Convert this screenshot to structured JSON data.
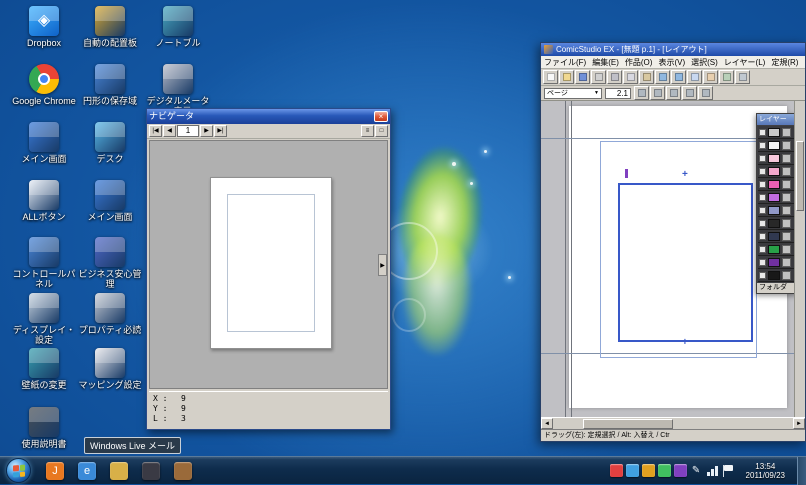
{
  "wallpaper": {
    "base_blue": "#10509a",
    "aurora_green": "#a6d83c"
  },
  "desktop": {
    "icons": [
      {
        "name": "dropbox",
        "label": "Dropbox",
        "kind": "dropbox",
        "color": "#1f8ce3",
        "col": 0,
        "row": 0
      },
      {
        "name": "google-chrome",
        "label": "Google Chrome",
        "kind": "chrome",
        "color": "#e8453c",
        "col": 0,
        "row": 1
      },
      {
        "name": "main-screen",
        "label": "メイン画面",
        "kind": "app",
        "color": "#3a7ad8",
        "col": 0,
        "row": 2
      },
      {
        "name": "all-button",
        "label": "ALLボタン",
        "kind": "app",
        "color": "#e8eef6",
        "col": 0,
        "row": 3
      },
      {
        "name": "control-panel",
        "label": "コントロールパネル",
        "kind": "app",
        "color": "#4a86d8",
        "col": 0,
        "row": 4
      },
      {
        "name": "display-settings",
        "label": "ディスプレイ・設定",
        "kind": "app",
        "color": "#c8d4e0",
        "col": 0,
        "row": 5
      },
      {
        "name": "wallpaper-change",
        "label": "壁紙の変更",
        "kind": "app",
        "color": "#38a0b0",
        "col": 0,
        "row": 6
      },
      {
        "name": "manual",
        "label": "使用説明書",
        "kind": "app",
        "color": "#485058",
        "col": 0,
        "row": 7
      },
      {
        "name": "auto-layout",
        "label": "自動の配置板",
        "kind": "app",
        "color": "#d8a830",
        "col": 1,
        "row": 0
      },
      {
        "name": "backup-area",
        "label": "円形の保存域",
        "kind": "app",
        "color": "#4a86d8",
        "col": 1,
        "row": 1
      },
      {
        "name": "desk",
        "label": "デスク",
        "kind": "app",
        "color": "#58b8e8",
        "col": 1,
        "row": 2
      },
      {
        "name": "main-screen-2",
        "label": "メイン画面",
        "kind": "app",
        "color": "#3a7ad8",
        "col": 1,
        "row": 3
      },
      {
        "name": "business-admin",
        "label": "ビジネス安心管理",
        "kind": "app",
        "color": "#5068c8",
        "col": 1,
        "row": 4
      },
      {
        "name": "property-readme",
        "label": "プロパティ必読",
        "kind": "app",
        "color": "#c8ccd4",
        "col": 1,
        "row": 5
      },
      {
        "name": "mapping-settings",
        "label": "マッピング設定",
        "kind": "app",
        "color": "#e8e8ec",
        "col": 1,
        "row": 6
      },
      {
        "name": "notable",
        "label": "ノートブル",
        "kind": "app",
        "color": "#48a8c0",
        "col": 2,
        "row": 0
      },
      {
        "name": "digital-meter",
        "label": "デジタルメーター表示",
        "kind": "app",
        "color": "#b8bcc8",
        "col": 2,
        "row": 1
      }
    ]
  },
  "navigator": {
    "title": "ナビゲータ",
    "close_label": "×",
    "toolbar": {
      "first": "|◀",
      "prev": "◀",
      "page": "1",
      "next": "▶",
      "last": "▶|",
      "view_buttons": [
        "≡",
        "□"
      ]
    },
    "readout": [
      {
        "label": "X :",
        "value": "9"
      },
      {
        "label": "Y :",
        "value": "9"
      },
      {
        "label": "L :",
        "value": "3"
      }
    ]
  },
  "comicstudio": {
    "title": "ComicStudio EX - [無題 p.1] - [レイアウト]",
    "menus": [
      "ファイル(F)",
      "編集(E)",
      "作品(O)",
      "表示(V)",
      "選択(S)",
      "レイヤー(L)",
      "定規(R)"
    ],
    "toolbar_icons": [
      {
        "name": "new",
        "color": "#f8f8f8"
      },
      {
        "name": "open",
        "color": "#f0d890"
      },
      {
        "name": "save",
        "color": "#7090d8"
      },
      {
        "name": "print",
        "color": "#d0d0d0"
      },
      {
        "name": "cut",
        "color": "#c0c0c8"
      },
      {
        "name": "copy",
        "color": "#d8d8e0"
      },
      {
        "name": "paste",
        "color": "#d8c8a0"
      },
      {
        "name": "undo",
        "color": "#90b8e0"
      },
      {
        "name": "redo",
        "color": "#90b8e0"
      },
      {
        "name": "zoom",
        "color": "#c8d8f0"
      },
      {
        "name": "hand",
        "color": "#e8d0b0"
      },
      {
        "name": "rotate",
        "color": "#b8d0b8"
      },
      {
        "name": "grid",
        "color": "#c0c8d0"
      }
    ],
    "page_toolbar": {
      "label": "ページ",
      "zoom": "2.1",
      "buttons": [
        "prev-page",
        "next-page",
        "fit-view",
        "actual-size",
        "rotate-view"
      ]
    },
    "palette": {
      "title": "レイヤー",
      "rows": [
        {
          "color": "#c8c8c8"
        },
        {
          "color": "#f4f4f4"
        },
        {
          "color": "#f8c8dc"
        },
        {
          "color": "#f4a8cc"
        },
        {
          "color": "#ec60b4"
        },
        {
          "color": "#c06ce0"
        },
        {
          "color": "#9098c8"
        },
        {
          "color": "#282828"
        },
        {
          "color": "#303850"
        },
        {
          "color": "#28a048"
        },
        {
          "color": "#7030a0"
        },
        {
          "color": "#181818"
        }
      ],
      "footer": "フォルダ"
    },
    "status": "ドラッグ(左): 定規選択 / Alt: 入替え / Ctr"
  },
  "taskbar": {
    "quick_launch": [
      {
        "name": "jword",
        "glyph": "J",
        "color": "#e87820"
      },
      {
        "name": "browser",
        "glyph": "e",
        "color": "#3a8ad8"
      },
      {
        "name": "folder",
        "glyph": "",
        "color": "#d8b048"
      },
      {
        "name": "media-device",
        "glyph": "",
        "color": "#3a3a44"
      },
      {
        "name": "package",
        "glyph": "",
        "color": "#9a6a3a"
      }
    ],
    "tray": [
      {
        "name": "antivirus",
        "color": "#e04040"
      },
      {
        "name": "messenger",
        "color": "#40a0e0"
      },
      {
        "name": "cloud",
        "color": "#e0a020"
      },
      {
        "name": "security",
        "color": "#40c060"
      },
      {
        "name": "ime",
        "color": "#8040c0"
      },
      {
        "name": "pen-input",
        "glyph": "✎",
        "color": ""
      }
    ],
    "clock": {
      "time": "13:54",
      "date": "2011/09/23"
    },
    "tooltip": "Windows Live メール"
  }
}
